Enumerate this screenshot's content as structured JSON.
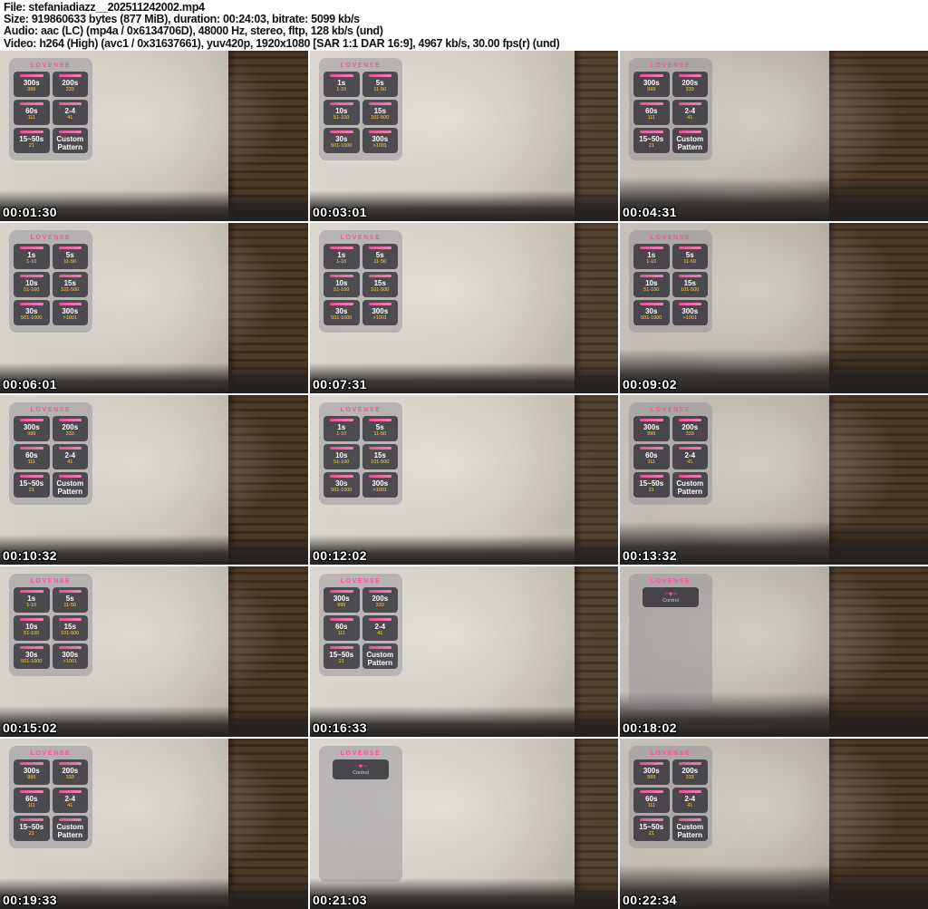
{
  "header": {
    "lines": [
      "File: stefaniadiazz__202511242002.mp4",
      "Size: 919860633 bytes (877 MiB), duration: 00:24:03, bitrate: 5099 kb/s",
      "Audio: aac (LC) (mp4a / 0x6134706D), 48000 Hz, stereo, fltp, 128 kb/s (und)",
      "Video: h264 (High) (avc1 / 0x31637661), yuv420p, 1920x1080 [SAR 1:1 DAR 16:9], 4967 kb/s, 30.00 fps(r) (und)"
    ]
  },
  "thumbnails": [
    {
      "timestamp": "00:01:30",
      "overlay": "menu_b"
    },
    {
      "timestamp": "00:03:01",
      "overlay": "menu_a"
    },
    {
      "timestamp": "00:04:31",
      "overlay": "menu_b"
    },
    {
      "timestamp": "00:06:01",
      "overlay": "menu_a"
    },
    {
      "timestamp": "00:07:31",
      "overlay": "menu_a"
    },
    {
      "timestamp": "00:09:02",
      "overlay": "menu_a"
    },
    {
      "timestamp": "00:10:32",
      "overlay": "menu_b"
    },
    {
      "timestamp": "00:12:02",
      "overlay": "menu_a"
    },
    {
      "timestamp": "00:13:32",
      "overlay": "menu_b"
    },
    {
      "timestamp": "00:15:02",
      "overlay": "menu_a"
    },
    {
      "timestamp": "00:16:33",
      "overlay": "menu_b"
    },
    {
      "timestamp": "00:18:02",
      "overlay": "control"
    },
    {
      "timestamp": "00:19:33",
      "overlay": "menu_b"
    },
    {
      "timestamp": "00:21:03",
      "overlay": "control"
    },
    {
      "timestamp": "00:22:34",
      "overlay": "menu_b"
    }
  ],
  "overlays": {
    "menu_a": {
      "title": "LOVENSE",
      "tiles": [
        {
          "value": "1s",
          "sub": "1-10"
        },
        {
          "value": "5s",
          "sub": "11-50"
        },
        {
          "value": "10s",
          "sub": "51-100"
        },
        {
          "value": "15s",
          "sub": "101-500"
        },
        {
          "value": "30s",
          "sub": "501-1000"
        },
        {
          "value": "300s",
          "sub": ">1001"
        }
      ]
    },
    "menu_b": {
      "title": "LOVENSE",
      "tiles": [
        {
          "value": "300s",
          "sub": "999"
        },
        {
          "value": "200s",
          "sub": "333"
        },
        {
          "value": "60s",
          "sub": "111"
        },
        {
          "value": "2-4",
          "sub": "41"
        },
        {
          "value": "15~50s",
          "sub": "21"
        },
        {
          "value": "Custom Pattern",
          "sub": ""
        }
      ]
    },
    "control": {
      "title": "LOVENSE",
      "icon": "toy-wave",
      "label": "Control"
    }
  },
  "colors": {
    "accent_pink": "#ff4fa0",
    "token_yellow": "#ffd34d",
    "timestamp_text": "#ffffff",
    "header_text": "#111111",
    "background": "#ffffff"
  }
}
